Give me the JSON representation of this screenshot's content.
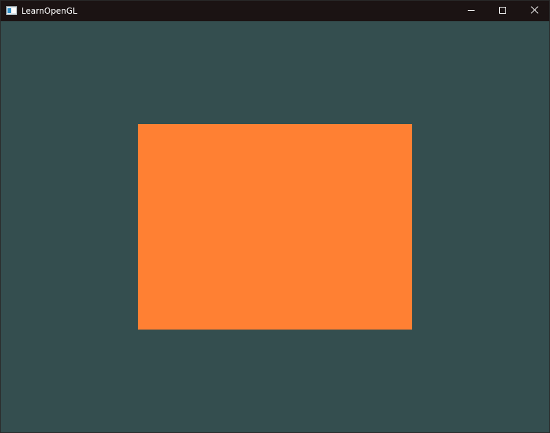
{
  "window": {
    "title": "LearnOpenGL",
    "app_icon": "window-app-icon",
    "controls": {
      "minimize_icon": "minimize-icon",
      "maximize_icon": "maximize-icon",
      "close_icon": "close-icon"
    }
  },
  "viewport": {
    "clear_color": "#344e4f",
    "quad_color": "#ff8033"
  }
}
